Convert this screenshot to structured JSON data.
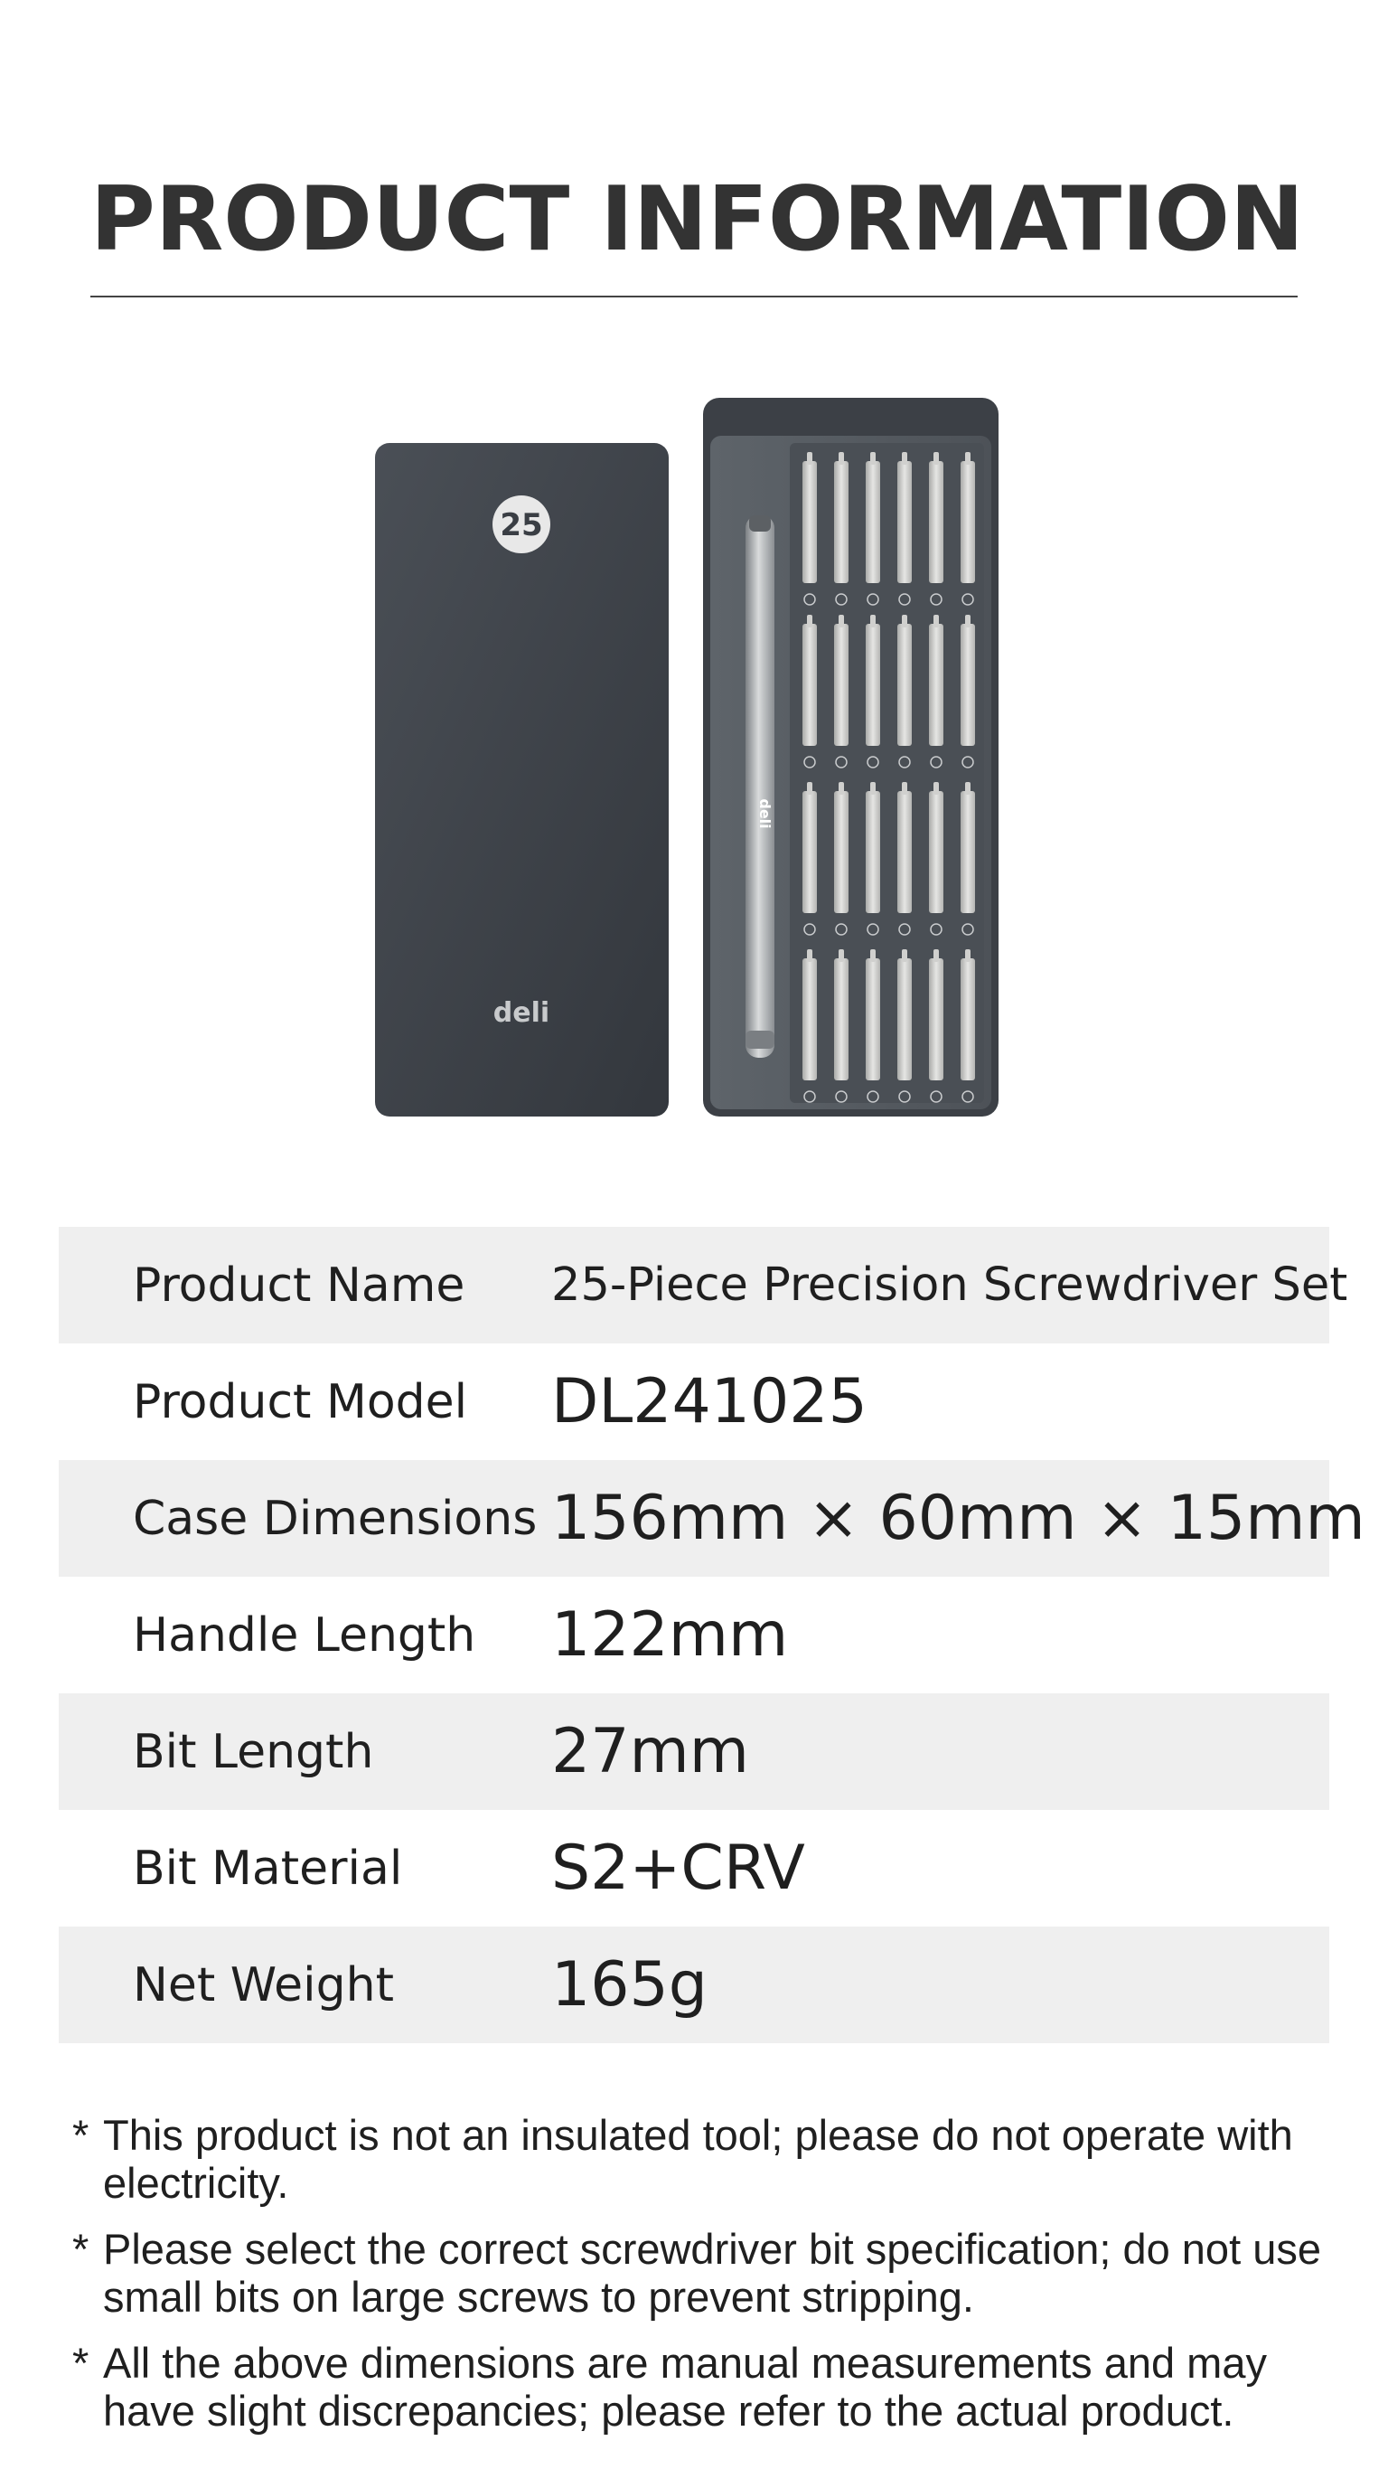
{
  "header": {
    "title": "PRODUCT INFORMATION"
  },
  "product_image": {
    "case_badge": "25",
    "brand_logo": "deli",
    "handle_logo": "deli",
    "case_color": "#3d4249",
    "tray_color": "#575d63",
    "bit_color": "#d8d8d6"
  },
  "specs": [
    {
      "label": "Product Name",
      "value": "25-Piece Precision Screwdriver Set"
    },
    {
      "label": "Product Model",
      "value": "DL241025"
    },
    {
      "label": "Case Dimensions",
      "value": "156mm × 60mm × 15mm"
    },
    {
      "label": "Handle Length",
      "value": "122mm"
    },
    {
      "label": "Bit Length",
      "value": "27mm"
    },
    {
      "label": "Bit Material",
      "value": "S2+CRV"
    },
    {
      "label": "Net Weight",
      "value": "165g"
    }
  ],
  "notes": [
    {
      "star": "*",
      "text": "This product is not an insulated tool; please do not operate with electricity."
    },
    {
      "star": "*",
      "text": "Please select the correct screwdriver bit specification; do not use small bits on large screws to prevent stripping."
    },
    {
      "star": "*",
      "text": "All the above dimensions are manual measurements and may have slight discrepancies; please refer to the actual product."
    }
  ],
  "colors": {
    "title": "#333333",
    "row_shade": "#efefef",
    "text": "#1f1f1f"
  }
}
